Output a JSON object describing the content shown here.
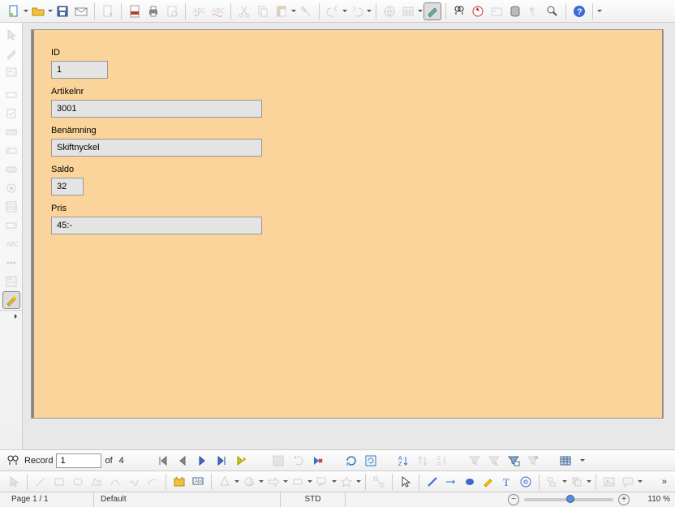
{
  "form": {
    "labels": {
      "id": "ID",
      "artikelnr": "Artikelnr",
      "benamning": "Benämning",
      "saldo": "Saldo",
      "pris": "Pris"
    },
    "values": {
      "id": "1",
      "artikelnr": "3001",
      "benamning": "Skiftnyckel",
      "saldo": "32",
      "pris": "45:-"
    }
  },
  "record_nav": {
    "label": "Record",
    "current": "1",
    "of_label": "of",
    "total": "4"
  },
  "statusbar": {
    "page": "Page 1 / 1",
    "style": "Default",
    "mode": "STD",
    "zoom": "110 %"
  }
}
